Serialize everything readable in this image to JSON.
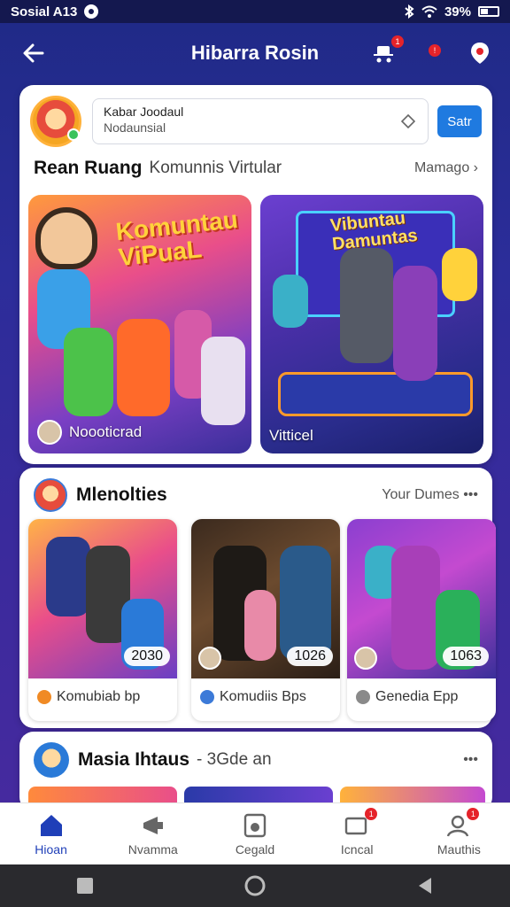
{
  "status_bar": {
    "carrier": "Sosial A13",
    "battery": "39%"
  },
  "app_bar": {
    "title": "Hibarra Rosin"
  },
  "profile": {
    "search_line1": "Kabar Joodaul",
    "search_line2": "Nodaunsial",
    "start_label": "Satr"
  },
  "section1": {
    "title": "Rean Ruang",
    "subtitle": "Komunnis Virtular",
    "more": "Mamago ›",
    "tiles": [
      {
        "overlay": "Komuntau\nViPuaL",
        "caption": "Noooticrad"
      },
      {
        "overlay": "Vibuntau\nDamuntas",
        "caption": "Vitticel"
      }
    ]
  },
  "section2": {
    "title": "Mlenolties",
    "more": "Your Dumes •••",
    "tiles": [
      {
        "count": "2030",
        "label": "Komubiab bp",
        "dot_color": "#f08a24"
      },
      {
        "count": "1026",
        "label": "Komudiis Bps",
        "dot_color": "#3c7ad8"
      },
      {
        "count": "1063",
        "label": "Genedia Epp",
        "dot_color": "#8a8a8a"
      }
    ]
  },
  "section3": {
    "title": "Masia Ihtaus",
    "subtitle": "- 3Gde an",
    "more": "•••"
  },
  "bottom_nav": [
    {
      "label": "Hioan",
      "icon": "home-icon"
    },
    {
      "label": "Nvamma",
      "icon": "megaphone-icon"
    },
    {
      "label": "Cegald",
      "icon": "music-player-icon"
    },
    {
      "label": "Icncal",
      "icon": "video-icon"
    },
    {
      "label": "Mauthis",
      "icon": "profile-settings-icon"
    }
  ],
  "colors": {
    "accent": "#1f3fb8",
    "badge": "#e5232a",
    "start_button": "#1f7ae0"
  }
}
